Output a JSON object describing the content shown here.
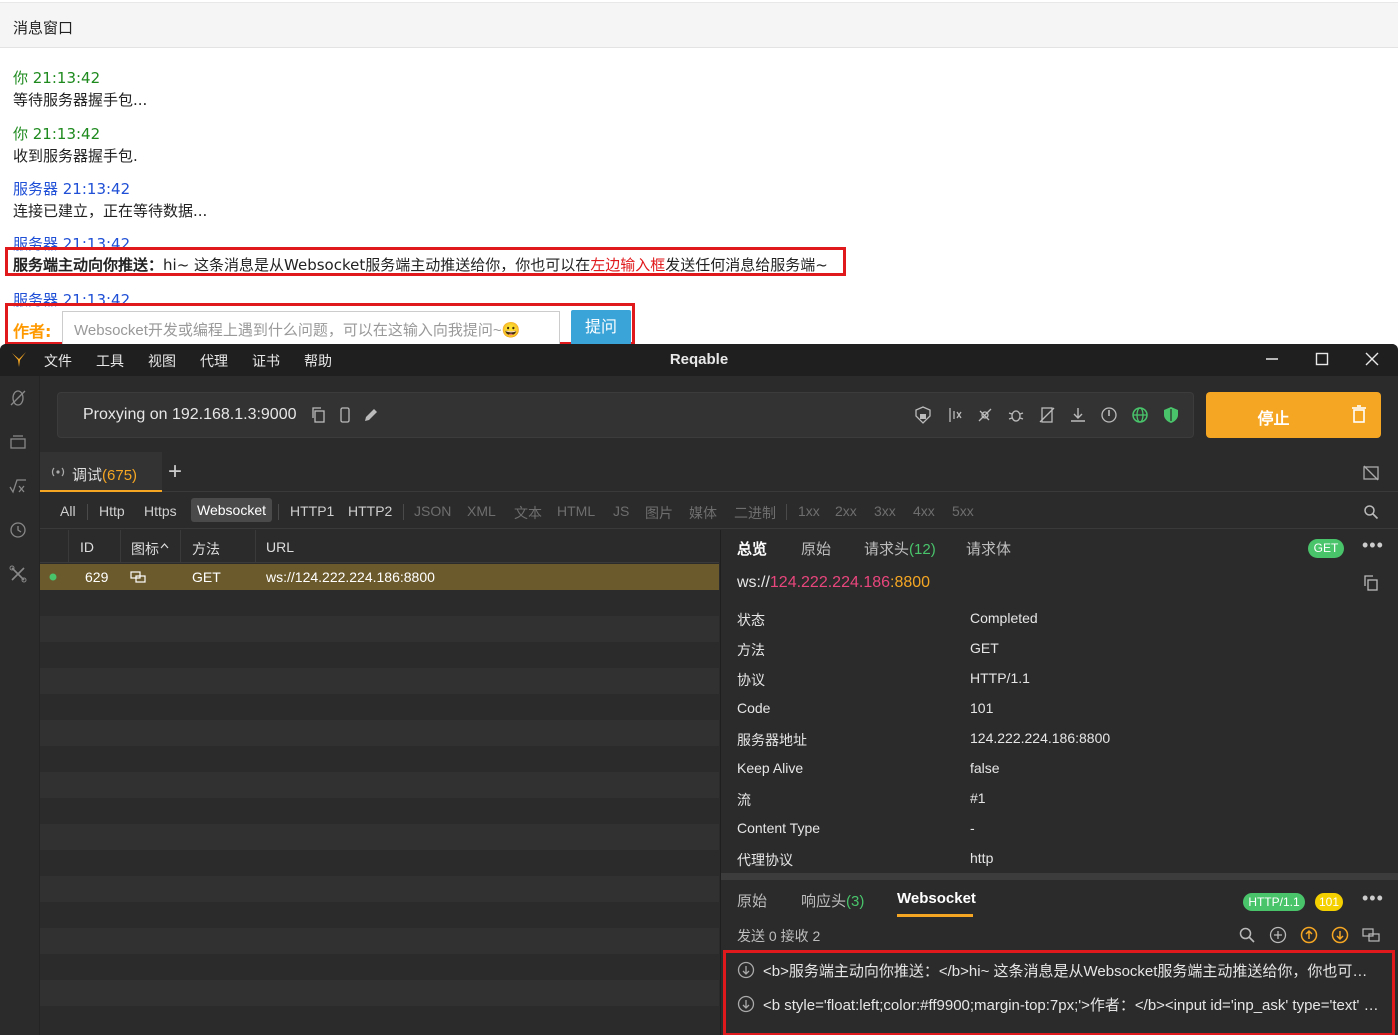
{
  "browser": {
    "window_title": "消息窗口",
    "messages": [
      {
        "sender": "你 21:13:42",
        "text": "等待服务器握手包..."
      },
      {
        "sender": "你 21:13:42",
        "text": "收到服务器握手包."
      },
      {
        "sender": "服务器 21:13:42",
        "text": "连接已建立，正在等待数据..."
      },
      {
        "sender": "服务器 21:13:42"
      },
      {
        "sender": "服务器 21:13:42"
      }
    ],
    "push": {
      "bold": "服务端主动向你推送：",
      "text_a": "hi~ 这条消息是从Websocket服务端主动推送给你，你也可以在",
      "text_red": "左边输入框",
      "text_b": "发送任何消息给服务端~"
    },
    "author_label": "作者:",
    "ask_placeholder": "Websocket开发或编程上遇到什么问题，可以在这输入向我提问~😀",
    "ask_button": "提问"
  },
  "app": {
    "title": "Reqable",
    "menu": [
      "文件",
      "工具",
      "视图",
      "代理",
      "证书",
      "帮助"
    ],
    "proxy_text": "Proxying on 192.168.1.3:9000",
    "stop_label": "停止",
    "tab_label": "调试",
    "tab_count": "(675)",
    "filters": [
      "All",
      "Http",
      "Https",
      "Websocket",
      "HTTP1",
      "HTTP2",
      "JSON",
      "XML",
      "文本",
      "HTML",
      "JS",
      "图片",
      "媒体",
      "二进制",
      "1xx",
      "2xx",
      "3xx",
      "4xx",
      "5xx"
    ],
    "active_filter": "Websocket",
    "columns": [
      "ID",
      "图标",
      "方法",
      "URL"
    ],
    "rows": [
      {
        "id": "629",
        "method": "GET",
        "url": "ws://124.222.224.186:8800"
      }
    ],
    "detail": {
      "tabs": [
        "总览",
        "原始",
        "请求头",
        "请求体"
      ],
      "header_count": "(12)",
      "method_badge": "GET",
      "url_scheme": "ws://",
      "url_host": "124.222.224.186",
      "url_port": ":8800",
      "fields": [
        {
          "k": "状态",
          "v": "Completed"
        },
        {
          "k": "方法",
          "v": "GET"
        },
        {
          "k": "协议",
          "v": "HTTP/1.1"
        },
        {
          "k": "Code",
          "v": "101"
        },
        {
          "k": "服务器地址",
          "v": "124.222.224.186:8800"
        },
        {
          "k": "Keep Alive",
          "v": "false"
        },
        {
          "k": "流",
          "v": "#1"
        },
        {
          "k": "Content Type",
          "v": "-"
        },
        {
          "k": "代理协议",
          "v": "http"
        }
      ],
      "bottom_tabs": [
        "原始",
        "响应头",
        "Websocket"
      ],
      "resp_header_count": "(3)",
      "http_badge": "HTTP/1.1",
      "code_badge": "101",
      "send_recv": "发送 0 接收 2",
      "ws_messages": [
        "<b>服务端主动向你推送：</b>hi~ 这条消息是从Websocket服务端主动推送给你，你也可以在左边输入框发送任何消息给服务端~",
        "<b style='float:left;color:#ff9900;margin-top:7px;'>作者：</b><input id='inp_ask' type='text' placeholder='Websocket开发或编程上遇到什么问题'>"
      ]
    }
  },
  "colors": {
    "accent": "#f5a623",
    "green": "#49c46b",
    "red": "#e0191c",
    "link_blue": "#1f4fd6"
  }
}
